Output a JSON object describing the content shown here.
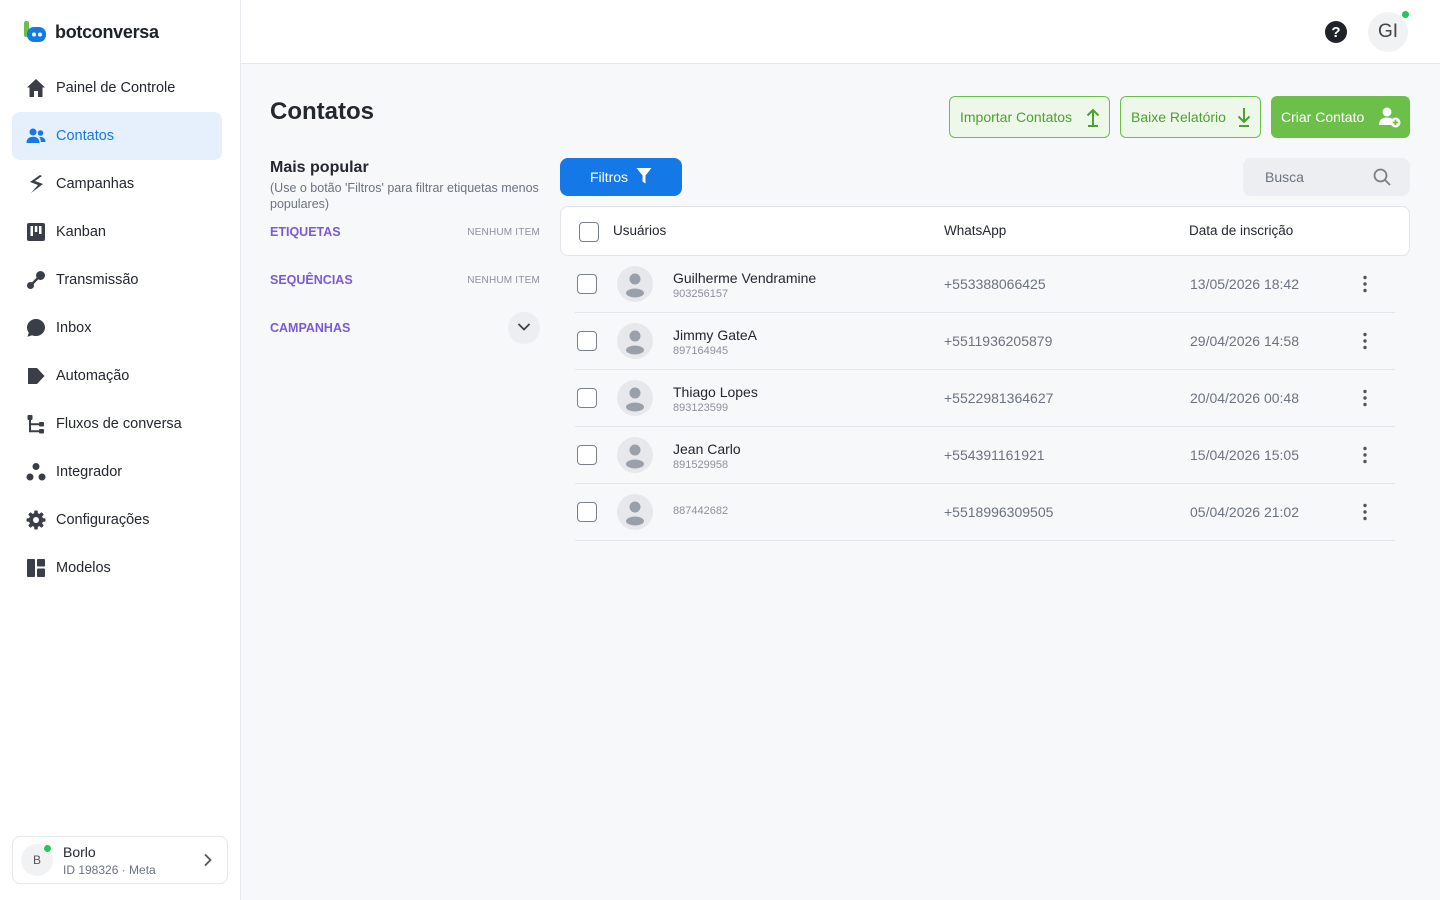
{
  "app": {
    "brand": "botconversa"
  },
  "sidebar": {
    "items": [
      {
        "label": "Painel de Controle",
        "icon": "home-icon"
      },
      {
        "label": "Contatos",
        "icon": "users-icon",
        "active": true
      },
      {
        "label": "Campanhas",
        "icon": "campaigns-icon"
      },
      {
        "label": "Kanban",
        "icon": "kanban-icon"
      },
      {
        "label": "Transmissão",
        "icon": "broadcast-icon"
      },
      {
        "label": "Inbox",
        "icon": "chat-bubble-icon"
      },
      {
        "label": "Automação",
        "icon": "automation-tag-icon"
      },
      {
        "label": "Fluxos de conversa",
        "icon": "flow-icon"
      },
      {
        "label": "Integrador",
        "icon": "integrator-icon"
      },
      {
        "label": "Configurações",
        "icon": "gear-icon"
      },
      {
        "label": "Modelos",
        "icon": "templates-icon"
      }
    ],
    "bot": {
      "initial": "B",
      "name": "Borlo",
      "meta": "ID 198326 · Meta"
    }
  },
  "topbar": {
    "help": "?",
    "user_initials": "GI"
  },
  "page": {
    "title": "Contatos",
    "actions": {
      "import": "Importar Contatos",
      "report": "Baixe Relatório",
      "create": "Criar Contato"
    }
  },
  "filters_panel": {
    "title": "Mais popular",
    "subtitle": "(Use o botão 'Filtros' para filtrar etiquetas menos populares)",
    "groups": [
      {
        "name": "ETIQUETAS",
        "status": "NENHUM ITEM"
      },
      {
        "name": "SEQUÊNCIAS",
        "status": "NENHUM ITEM"
      },
      {
        "name": "CAMPANHAS",
        "status": ""
      }
    ]
  },
  "toolbar": {
    "filters_label": "Filtros",
    "search_placeholder": "Busca"
  },
  "table": {
    "columns": [
      "Usuários",
      "WhatsApp",
      "Data de inscrição"
    ],
    "rows": [
      {
        "name": "Guilherme Vendramine",
        "id": "903256157",
        "phone": "+553388066425",
        "date": "13/05/2026 18:42"
      },
      {
        "name": "Jimmy GateA",
        "id": "897164945",
        "phone": "+5511936205879",
        "date": "29/04/2026 14:58"
      },
      {
        "name": "Thiago Lopes",
        "id": "893123599",
        "phone": "+5522981364627",
        "date": "20/04/2026 00:48"
      },
      {
        "name": "Jean Carlo",
        "id": "891529958",
        "phone": "+554391161921",
        "date": "15/04/2026 15:05"
      },
      {
        "name": "",
        "id": "887442682",
        "phone": "+5518996309505",
        "date": "05/04/2026 21:02"
      }
    ]
  },
  "colors": {
    "primary": "#1479e6",
    "green": "#6cc04a",
    "purple": "#7c5ad7",
    "online": "#22c55e"
  }
}
